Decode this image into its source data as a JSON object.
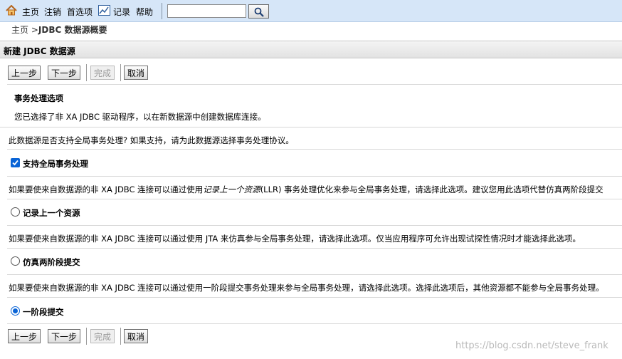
{
  "nav": {
    "home": "主页",
    "logout": "注销",
    "preferences": "首选项",
    "record": "记录",
    "help": "帮助",
    "search_value": ""
  },
  "breadcrumb": {
    "home": "主页",
    "separator": " >",
    "current": "JDBC 数据源概要"
  },
  "panel": {
    "title": "新建 JDBC 数据源"
  },
  "buttons": {
    "back": "上一步",
    "next": "下一步",
    "finish": "完成",
    "cancel": "取消"
  },
  "content": {
    "section_title": "事务处理选项",
    "intro": "您已选择了非 XA JDBC 驱动程序，以在新数据源中创建数据库连接。",
    "question": "此数据源是否支持全局事务处理? 如果支持，请为此数据源选择事务处理协议。",
    "support_global_label": "支持全局事务处理",
    "support_global_checked": true,
    "llr_desc_prefix": "如果要使来自数据源的非 XA JDBC 连接可以通过使用",
    "llr_desc_italic": "记录上一个资源",
    "llr_desc_suffix": "(LLR) 事务处理优化来参与全局事务处理，请选择此选项。建议您用此选项代替仿真两阶段提交",
    "llr_label": "记录上一个资源",
    "emulate_desc": "如果要使来自数据源的非 XA JDBC 连接可以通过使用 JTA 来仿真参与全局事务处理，请选择此选项。仅当应用程序可允许出现试探性情况时才能选择此选项。",
    "emulate_label": "仿真两阶段提交",
    "onephase_desc": "如果要使来自数据源的非 XA JDBC 连接可以通过使用一阶段提交事务处理来参与全局事务处理，请选择此选项。选择此选项后，其他资源都不能参与全局事务处理。",
    "onephase_label": "一阶段提交",
    "selected_protocol": "一阶段提交"
  },
  "watermark": "https://blog.csdn.net/steve_frank",
  "colors": {
    "topbar": "#d6e6f8",
    "accent": "#0a64d6"
  }
}
